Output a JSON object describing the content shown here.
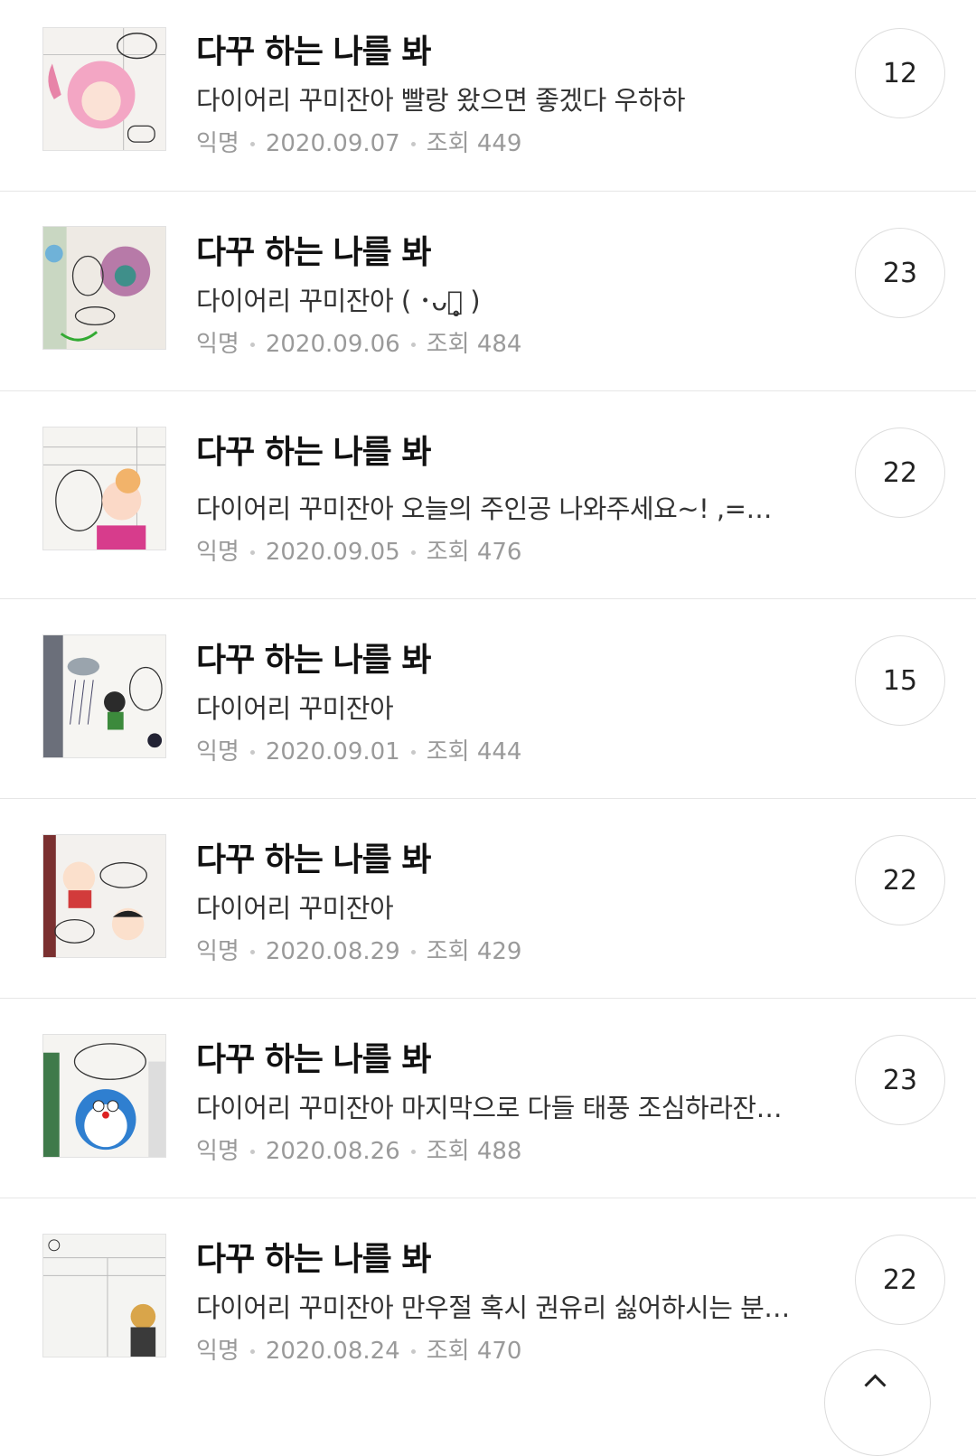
{
  "posts": [
    {
      "title": "다꾸 하는 나를 봐",
      "description": "다이어리 꾸미잔아 빨랑 왔으면 좋겠다 우하하",
      "author": "익명",
      "date": "2020.09.07",
      "views": "조회 449",
      "comments": "12",
      "thumbnail_icon": "diary-sticker-pink-hair-girl"
    },
    {
      "title": "다꾸 하는 나를 봐",
      "description": "다이어리 꾸미잔아 ( ･ᴗ･̥̥̥ )",
      "author": "익명",
      "date": "2020.09.06",
      "views": "조회 484",
      "comments": "23",
      "thumbnail_icon": "diary-sticker-peacock"
    },
    {
      "title": "다꾸 하는 나를 봐",
      "description": "다이어리 꾸미잔아 오늘의 주인공 나와주세요~! ,===、...",
      "author": "익명",
      "date": "2020.09.05",
      "views": "조회 476",
      "comments": "22",
      "thumbnail_icon": "diary-sticker-crying-girl"
    },
    {
      "title": "다꾸 하는 나를 봐",
      "description": "다이어리 꾸미잔아",
      "author": "익명",
      "date": "2020.09.01",
      "views": "조회 444",
      "comments": "15",
      "thumbnail_icon": "diary-sticker-rain-boy"
    },
    {
      "title": "다꾸 하는 나를 봐",
      "description": "다이어리 꾸미잔아",
      "author": "익명",
      "date": "2020.08.29",
      "views": "조회 429",
      "comments": "22",
      "thumbnail_icon": "diary-sticker-cartoon-kids"
    },
    {
      "title": "다꾸 하는 나를 봐",
      "description": "다이어리 꾸미잔아 마지막으로 다들 태풍 조심하라잔아~!",
      "author": "익명",
      "date": "2020.08.26",
      "views": "조회 488",
      "comments": "23",
      "thumbnail_icon": "diary-sticker-blue-robot-cat"
    },
    {
      "title": "다꾸 하는 나를 봐",
      "description": "다이어리 꾸미잔아 만우절 혹시 권유리 싫어하시는 분 ...",
      "author": "익명",
      "date": "2020.08.24",
      "views": "조회 470",
      "comments": "22",
      "thumbnail_icon": "diary-sticker-blonde-character"
    }
  ],
  "scroll_top": {
    "icon": "chevron-up-icon"
  },
  "colors": {
    "title": "#111111",
    "description": "#333333",
    "meta": "#9a9a9a",
    "divider": "#e6e6e6"
  }
}
